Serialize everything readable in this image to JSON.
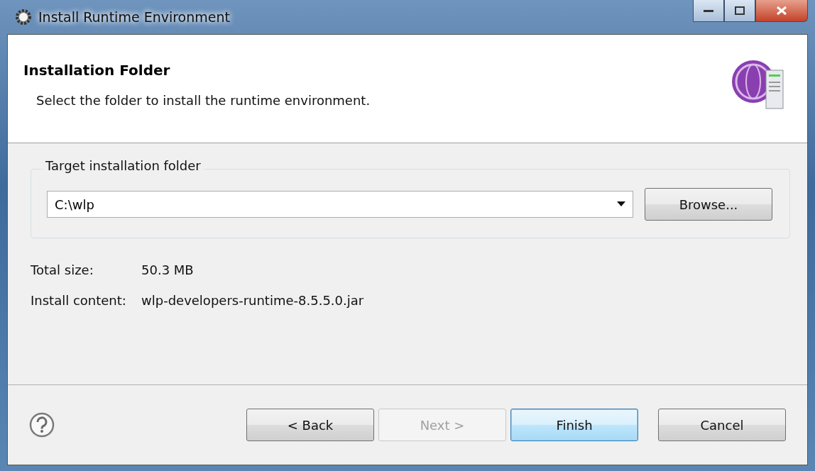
{
  "window": {
    "title": "Install Runtime Environment"
  },
  "header": {
    "title": "Installation Folder",
    "description": "Select the folder to install the runtime environment."
  },
  "target_group": {
    "label": "Target installation folder",
    "folder": {
      "value": "C:\\wlp"
    },
    "browse_button": "Browse..."
  },
  "details": [
    {
      "label": "Total size:",
      "value": "50.3 MB"
    },
    {
      "label": "Install content:",
      "value": "wlp-developers-runtime-8.5.5.0.jar"
    }
  ],
  "buttons": [
    {
      "label": "< Back",
      "disabled": false,
      "default": false
    },
    {
      "label": "Next >",
      "disabled": true,
      "default": false
    },
    {
      "label": "Finish",
      "disabled": false,
      "default": true
    },
    {
      "label": "Cancel",
      "disabled": false,
      "default": false
    }
  ]
}
